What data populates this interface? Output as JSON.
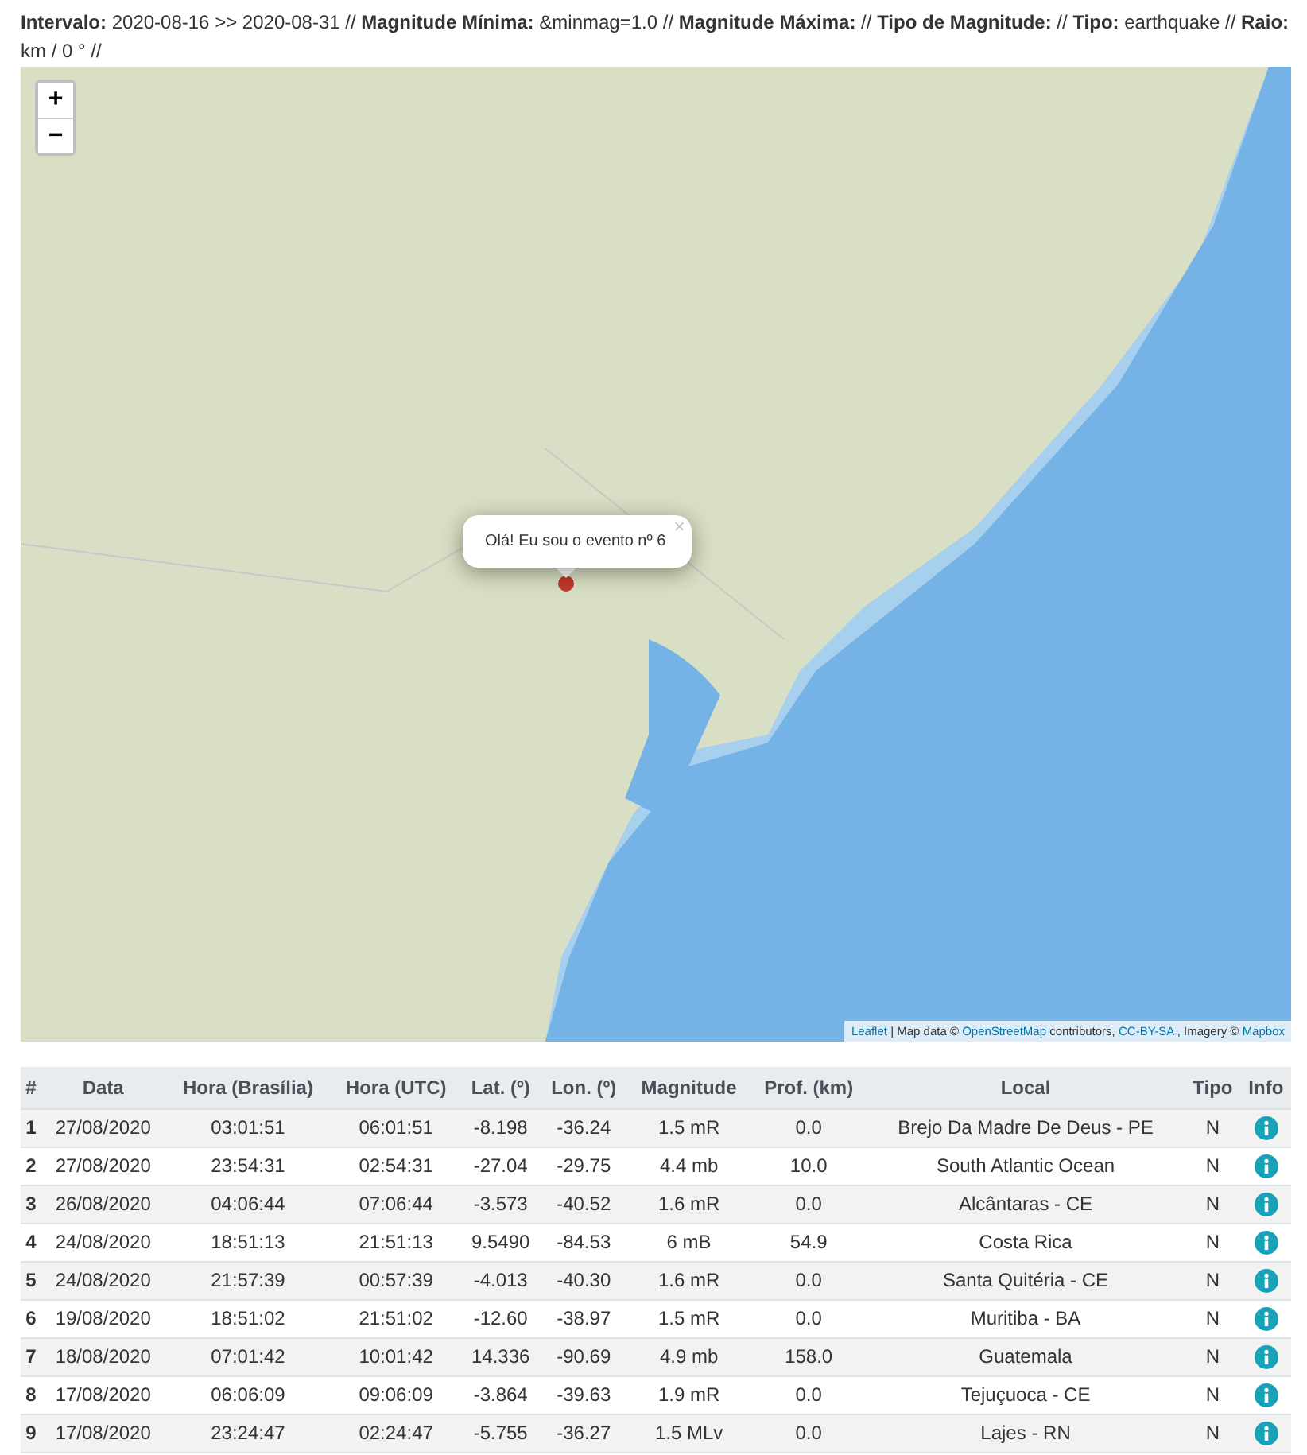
{
  "header": "**Intervalo:** 2020-08-16 >> 2020-08-31 // **Magnitude Mínima:** &minmag=1.0 // **Magnitude Máxima:** // **Tipo de Magnitude:** // **Tipo:** earthquake // **Raio:** km / 0 ° //",
  "map": {
    "zoom_in": "+",
    "zoom_out": "−",
    "popup": {
      "text": "Olá! Eu sou o evento nº 6",
      "close": "×"
    },
    "attribution": [
      {
        "kind": "link",
        "text": "Leaflet"
      },
      {
        "kind": "text",
        "text": "| Map data ©"
      },
      {
        "kind": "link",
        "text": "OpenStreetMap"
      },
      {
        "kind": "text",
        "text": "contributors,"
      },
      {
        "kind": "link",
        "text": "CC-BY-SA"
      },
      {
        "kind": "text",
        "text": ", Imagery ©"
      },
      {
        "kind": "link",
        "text": "Mapbox"
      }
    ]
  },
  "table": {
    "columns": [
      "#",
      "Data",
      "Hora (Brasília)",
      "Hora (UTC)",
      "Lat. (º)",
      "Lon. (º)",
      "Magnitude",
      "Prof. (km)",
      "Local",
      "Tipo",
      "Info"
    ],
    "rows": [
      [
        "1",
        "27/08/2020",
        "03:01:51",
        "06:01:51",
        "-8.198",
        "-36.24",
        "1.5 mR",
        "0.0",
        "Brejo Da Madre De Deus - PE",
        "N"
      ],
      [
        "2",
        "27/08/2020",
        "23:54:31",
        "02:54:31",
        "-27.04",
        "-29.75",
        "4.4 mb",
        "10.0",
        "South Atlantic Ocean",
        "N"
      ],
      [
        "3",
        "26/08/2020",
        "04:06:44",
        "07:06:44",
        "-3.573",
        "-40.52",
        "1.6 mR",
        "0.0",
        "Alcântaras - CE",
        "N"
      ],
      [
        "4",
        "24/08/2020",
        "18:51:13",
        "21:51:13",
        "9.5490",
        "-84.53",
        "6 mB",
        "54.9",
        "Costa Rica",
        "N"
      ],
      [
        "5",
        "24/08/2020",
        "21:57:39",
        "00:57:39",
        "-4.013",
        "-40.30",
        "1.6 mR",
        "0.0",
        "Santa Quitéria - CE",
        "N"
      ],
      [
        "6",
        "19/08/2020",
        "18:51:02",
        "21:51:02",
        "-12.60",
        "-38.97",
        "1.5 mR",
        "0.0",
        "Muritiba - BA",
        "N"
      ],
      [
        "7",
        "18/08/2020",
        "07:01:42",
        "10:01:42",
        "14.336",
        "-90.69",
        "4.9 mb",
        "158.0",
        "Guatemala",
        "N"
      ],
      [
        "8",
        "17/08/2020",
        "06:06:09",
        "09:06:09",
        "-3.864",
        "-39.63",
        "1.9 mR",
        "0.0",
        "Tejuçuoca - CE",
        "N"
      ],
      [
        "9",
        "17/08/2020",
        "23:24:47",
        "02:24:47",
        "-5.755",
        "-36.27",
        "1.5 MLv",
        "0.0",
        "Lajes - RN",
        "N"
      ]
    ]
  }
}
